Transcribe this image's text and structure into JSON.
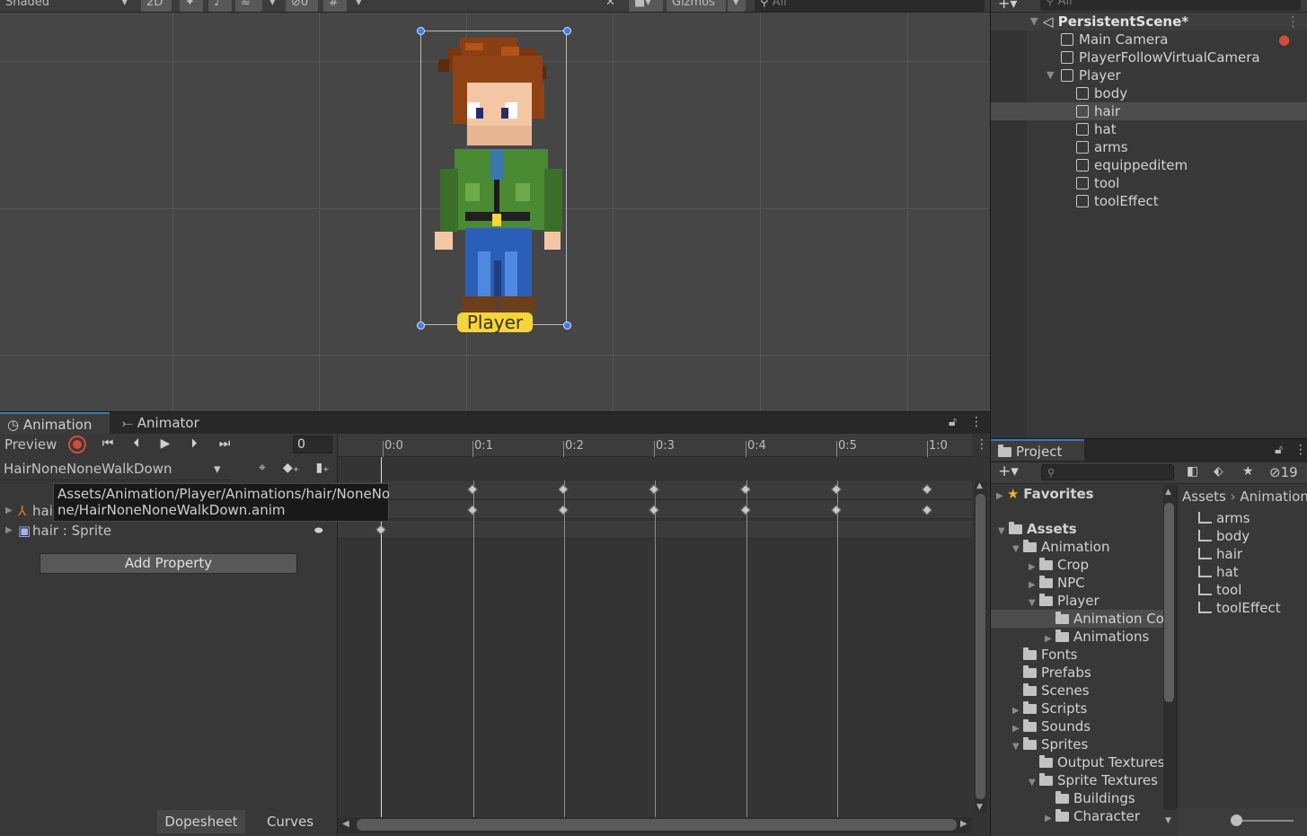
{
  "scene": {
    "toolbar": {
      "shading_mode": "Shaded",
      "mode_2d": "2D",
      "hidden_count": "0",
      "gizmos": "Gizmos",
      "search_placeholder": "All"
    },
    "player_label": "Player"
  },
  "hierarchy": {
    "search_placeholder": "All",
    "scene_name": "PersistentScene*",
    "items": [
      {
        "label": "Main Camera"
      },
      {
        "label": "PlayerFollowVirtualCamera"
      },
      {
        "label": "Player"
      },
      {
        "label": "body"
      },
      {
        "label": "hair"
      },
      {
        "label": "hat"
      },
      {
        "label": "arms"
      },
      {
        "label": "equippeditem"
      },
      {
        "label": "tool"
      },
      {
        "label": "toolEffect"
      }
    ]
  },
  "animation": {
    "tabs": [
      {
        "label": "Animation"
      },
      {
        "label": "Animator"
      }
    ],
    "preview_label": "Preview",
    "frame_value": "0",
    "clip_name": "HairNoneNoneWalkDown",
    "tooltip_line1": "Assets/Animation/Player/Animations/hair/NoneNo",
    "tooltip_line2": "ne/HairNoneNoneWalkDown.anim",
    "property_row1_prefix": "hai",
    "property_row2": "hair : Sprite",
    "add_property": "Add Property",
    "ruler_ticks": [
      "0:0",
      "0:1",
      "0:2",
      "0:3",
      "0:4",
      "0:5",
      "1:0"
    ],
    "bottom_tabs": [
      "Dopesheet",
      "Curves"
    ]
  },
  "project": {
    "tab_label": "Project",
    "hidden_count": "19",
    "breadcrumb": [
      "Assets",
      "Animation"
    ],
    "favorites": "Favorites",
    "tree": [
      {
        "label": "Assets"
      },
      {
        "label": "Animation"
      },
      {
        "label": "Crop"
      },
      {
        "label": "NPC"
      },
      {
        "label": "Player"
      },
      {
        "label": "Animation Co"
      },
      {
        "label": "Animations"
      },
      {
        "label": "Fonts"
      },
      {
        "label": "Prefabs"
      },
      {
        "label": "Scenes"
      },
      {
        "label": "Scripts"
      },
      {
        "label": "Sounds"
      },
      {
        "label": "Sprites"
      },
      {
        "label": "Output Textures"
      },
      {
        "label": "Sprite Textures"
      },
      {
        "label": "Buildings"
      },
      {
        "label": "Character"
      }
    ],
    "assets": [
      {
        "label": "arms"
      },
      {
        "label": "body"
      },
      {
        "label": "hair"
      },
      {
        "label": "hat"
      },
      {
        "label": "tool"
      },
      {
        "label": "toolEffect"
      }
    ]
  },
  "colors": {
    "selection": "#4d4d4d",
    "accent": "#3a79bb",
    "player_label_bg": "#f4d53a",
    "record": "#d24b3e"
  }
}
